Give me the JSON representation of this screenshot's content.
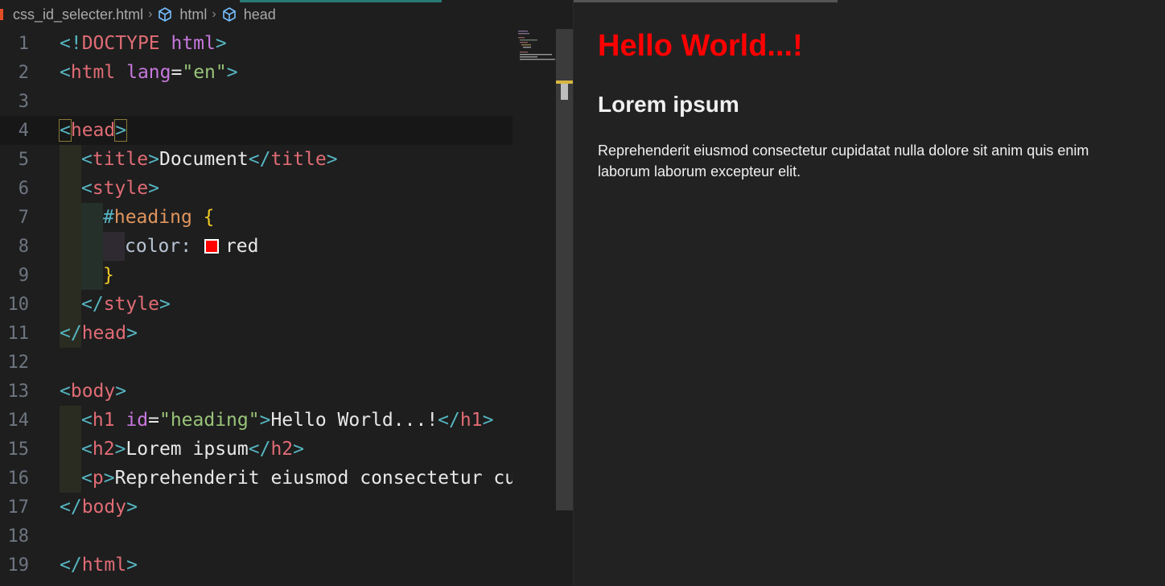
{
  "breadcrumb": {
    "file": "css_id_selecter.html",
    "items": [
      "html",
      "head"
    ]
  },
  "editor": {
    "line_numbers": [
      "1",
      "2",
      "3",
      "4",
      "5",
      "6",
      "7",
      "8",
      "9",
      "10",
      "11",
      "12",
      "13",
      "14",
      "15",
      "16",
      "17",
      "18",
      "19"
    ],
    "tokens": {
      "l1_open": "<!",
      "l1_doctype": "DOCTYPE",
      "l1_html": " html",
      "l1_close": ">",
      "l2_open": "<",
      "l2_tag": "html",
      "l2_attr": " lang",
      "l2_eq": "=",
      "l2_val": "\"en\"",
      "l2_close": ">",
      "l4_open": "<",
      "l4_tag": "head",
      "l4_close": ">",
      "l5_open": "<",
      "l5_tag": "title",
      "l5_close": ">",
      "l5_text": "Document",
      "l5_eopen": "</",
      "l5_etag": "title",
      "l5_eclose": ">",
      "l6_open": "<",
      "l6_tag": "style",
      "l6_close": ">",
      "l7_hash": "#",
      "l7_sel": "heading",
      "l7_brace": " {",
      "l8_prop": "color: ",
      "l8_val": "red",
      "l9_brace": "}",
      "l10_open": "</",
      "l10_tag": "style",
      "l10_close": ">",
      "l11_open": "</",
      "l11_tag": "head",
      "l11_close": ">",
      "l13_open": "<",
      "l13_tag": "body",
      "l13_close": ">",
      "l14_open": "<",
      "l14_tag": "h1",
      "l14_attr": " id",
      "l14_eq": "=",
      "l14_val": "\"heading\"",
      "l14_close": ">",
      "l14_text": "Hello World...!",
      "l14_eopen": "</",
      "l14_etag": "h1",
      "l14_eclose": ">",
      "l15_open": "<",
      "l15_tag": "h2",
      "l15_close": ">",
      "l15_text": "Lorem ipsum",
      "l15_eopen": "</",
      "l15_etag": "h2",
      "l15_eclose": ">",
      "l16_open": "<",
      "l16_tag": "p",
      "l16_close": ">",
      "l16_text": "Reprehenderit eiusmod consectetur cup",
      "l17_open": "</",
      "l17_tag": "body",
      "l17_close": ">",
      "l19_open": "</",
      "l19_tag": "html",
      "l19_close": ">"
    }
  },
  "preview": {
    "h1": "Hello World...!",
    "h2": "Lorem ipsum",
    "p": "Reprehenderit eiusmod consectetur cupidatat nulla dolore sit anim quis enim laborum laborum excepteur elit."
  },
  "colors": {
    "heading_red": "#ff0000",
    "editor_bg": "#1e1e1e",
    "preview_bg": "#222222"
  }
}
